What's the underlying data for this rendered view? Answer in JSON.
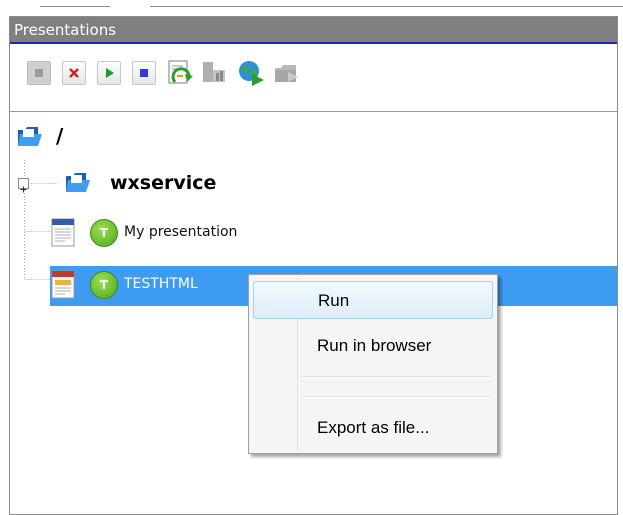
{
  "panel": {
    "title": "Presentations"
  },
  "toolbar": {
    "buttons": [
      {
        "name": "new-presentation-icon",
        "enabled": false
      },
      {
        "name": "delete-icon",
        "enabled": true
      },
      {
        "name": "play-icon",
        "enabled": true
      },
      {
        "name": "stop-icon",
        "enabled": true
      },
      {
        "name": "refresh-icon",
        "enabled": true
      },
      {
        "name": "chart-icon",
        "enabled": false
      },
      {
        "name": "globe-icon",
        "enabled": true
      },
      {
        "name": "export-icon",
        "enabled": false
      }
    ]
  },
  "tree": {
    "root_label": "/",
    "service_label": "wxservice",
    "items": [
      {
        "label": "My presentation",
        "avatar": "T",
        "doc_type": "TEXT"
      },
      {
        "label": "TESTHTML",
        "avatar": "T",
        "doc_type": "HTML",
        "selected": true
      }
    ]
  },
  "context_menu": {
    "items": [
      "Run",
      "Run in browser",
      "",
      "Export as file..."
    ]
  },
  "colors": {
    "selection": "#3d9bf0",
    "title_bar": "#7f7f7f",
    "title_border": "#1d2ea0",
    "avatar": "#6cc22e"
  }
}
